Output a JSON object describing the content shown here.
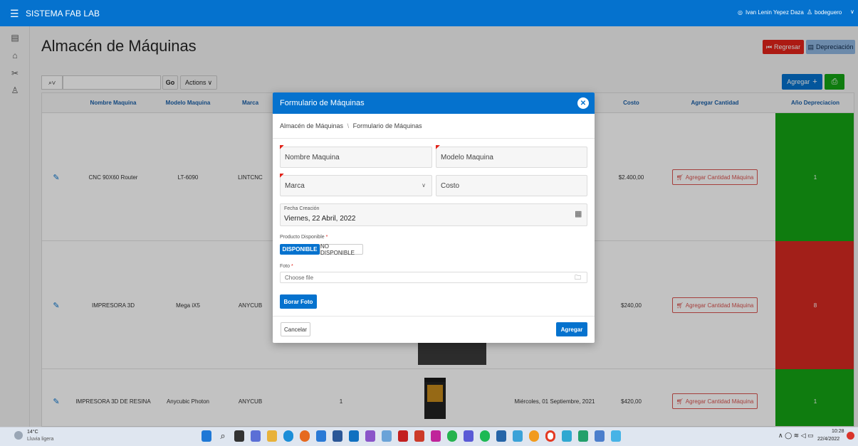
{
  "app": {
    "title": "SISTEMA FAB LAB",
    "user": "Ivan Lenin Yepez Daza",
    "role": "bodeguero"
  },
  "page": {
    "title": "Almacén de Máquinas",
    "back_label": "Regresar",
    "depreciation_label": "Depreciación"
  },
  "report": {
    "go_label": "Go",
    "actions_label": "Actions",
    "add_label": "Agregar"
  },
  "table": {
    "headers": [
      "Nombre Maquina",
      "Modelo Maquina",
      "Marca",
      "Costo",
      "Agregar Cantidad",
      "Año Depreciacion"
    ],
    "rows": [
      {
        "nombre": "CNC 90X60 Router",
        "modelo": "LT-6090",
        "marca": "LINTCNC",
        "cantidad": "",
        "fecha": "",
        "costo": "$2.400,00",
        "agregar": "Agregar Cantidad Máquina",
        "anio": "1",
        "color": "#14a314"
      },
      {
        "nombre": "IMPRESORA 3D",
        "modelo": "Mega iX5",
        "marca": "ANYCUB",
        "cantidad": "",
        "fecha": "",
        "costo": "$240,00",
        "agregar": "Agregar Cantidad Máquina",
        "anio": "8",
        "color": "#d52a22"
      },
      {
        "nombre": "IMPRESORA 3D DE RESINA",
        "modelo": "Anycubic Photon",
        "marca": "ANYCUB",
        "cantidad": "1",
        "fecha": "Miércoles, 01 Septiembre, 2021",
        "costo": "$420,00",
        "agregar": "Agregar Cantidad Máquina",
        "anio": "1",
        "color": "#14a314"
      }
    ]
  },
  "modal": {
    "title": "Formulario de Máquinas",
    "breadcrumb_parent": "Almacén de Máquinas",
    "breadcrumb_sep": "\\",
    "breadcrumb_current": "Formulario de Máquinas",
    "nombre_placeholder": "Nombre Maquina",
    "modelo_placeholder": "Modelo Maquina",
    "marca_placeholder": "Marca",
    "costo_placeholder": "Costo",
    "fecha_label": "Fecha Creación",
    "fecha_value": "Viernes, 22 Abril, 2022",
    "disponible_label": "Producto Disponible",
    "disponible_on": "DISPONIBLE",
    "disponible_off": "NO DISPONIBLE",
    "foto_label": "Foto",
    "foto_placeholder": "Choose file",
    "borrar_label": "Borar Foto",
    "cancel_label": "Cancelar",
    "submit_label": "Agregar",
    "required_mark": "*"
  },
  "taskbar": {
    "weather_temp": "14°C",
    "weather_desc": "Lluvia ligera",
    "time": "10:28",
    "date": "22/4/2022"
  },
  "colors": {
    "accent": "#0572ce",
    "danger": "#e2231a",
    "green": "#14a314",
    "red": "#d52a22",
    "depreciation_btn": "#8fb6e0"
  },
  "icons": [
    "menu-icon",
    "user-icon",
    "chevron-down-icon",
    "search-icon",
    "edit-icon",
    "cart-icon",
    "close-icon",
    "calendar-icon",
    "folder-icon",
    "print-icon",
    "back-icon",
    "plus-icon"
  ]
}
